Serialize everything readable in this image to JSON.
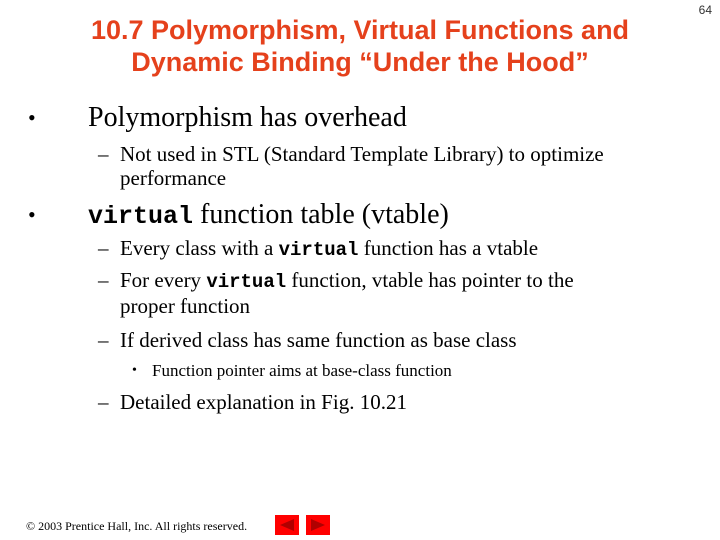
{
  "slide": {
    "title_line1": "10.7  Polymorphism, Virtual Functions and",
    "title_line2": "Dynamic Binding “Under the Hood”",
    "page_number": "64",
    "title_color": "#e5411c"
  },
  "bullets": [
    {
      "text": "Polymorphism has overhead",
      "sub": [
        {
          "line1": "Not used in STL (Standard Template Library) to optimize",
          "line2": "performance"
        }
      ]
    },
    {
      "code": "virtual",
      "text": " function table (vtable)",
      "sub": [
        {
          "pre": "Every class with a ",
          "code": "virtual",
          "post": " function has a vtable"
        },
        {
          "pre": "For every ",
          "code": "virtual",
          "post": " function, vtable has pointer to the",
          "line2": "proper function"
        },
        {
          "text": "If derived class has same function as base class",
          "sub": [
            {
              "text": "Function pointer aims at base-class function"
            }
          ]
        },
        {
          "text": "Detailed explanation in Fig. 10.21"
        }
      ]
    }
  ],
  "glyphs": {
    "bullet": "•",
    "dash": "–"
  },
  "footer": {
    "copyright": "© 2003 Prentice Hall, Inc.  All rights reserved.",
    "prev_icon": "prev-arrow-icon",
    "next_icon": "next-arrow-icon",
    "button_color": "#ff0000",
    "arrow_color": "#b00000"
  }
}
